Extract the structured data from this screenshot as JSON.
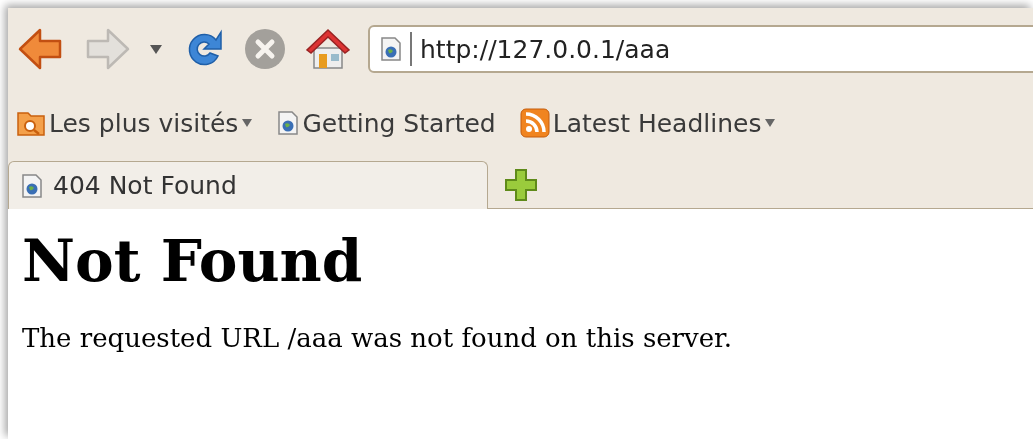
{
  "toolbar": {
    "buttons": [
      {
        "kind": "back",
        "disabled": false
      },
      {
        "kind": "forward",
        "disabled": true
      },
      {
        "kind": "history",
        "disabled": false
      },
      {
        "kind": "reload",
        "disabled": false
      },
      {
        "kind": "stop",
        "disabled": true
      },
      {
        "kind": "home",
        "disabled": false
      }
    ],
    "address": {
      "value": "http://127.0.0.1/aaa"
    }
  },
  "bookmarks": [
    {
      "kind": "folder",
      "label": "Les plus visités",
      "dropdown": true
    },
    {
      "kind": "page",
      "label": "Getting Started",
      "dropdown": false
    },
    {
      "kind": "feed",
      "label": "Latest Headlines",
      "dropdown": true
    }
  ],
  "tabs": [
    {
      "label": "404 Not Found",
      "selected": true
    }
  ],
  "page": {
    "heading": "Not Found",
    "paragraph": "The requested URL /aaa was not found on this server."
  }
}
